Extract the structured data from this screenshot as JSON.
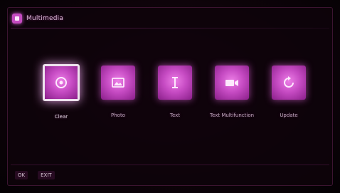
{
  "header": {
    "title": "Multimedia",
    "icon": "multimedia-icon"
  },
  "tiles": [
    {
      "label": "Clear",
      "icon": "clear-icon",
      "selected": true
    },
    {
      "label": "Photo",
      "icon": "photo-icon",
      "selected": false
    },
    {
      "label": "Text",
      "icon": "text-icon",
      "selected": false
    },
    {
      "label": "Text Multifunction",
      "icon": "video-icon",
      "selected": false
    },
    {
      "label": "Update",
      "icon": "update-icon",
      "selected": false
    }
  ],
  "footer": {
    "hints": [
      {
        "key": "OK",
        "label": ""
      },
      {
        "key": "EXIT",
        "label": ""
      }
    ]
  },
  "colors": {
    "accent": "#c64bc3",
    "background": "#0d0309"
  }
}
